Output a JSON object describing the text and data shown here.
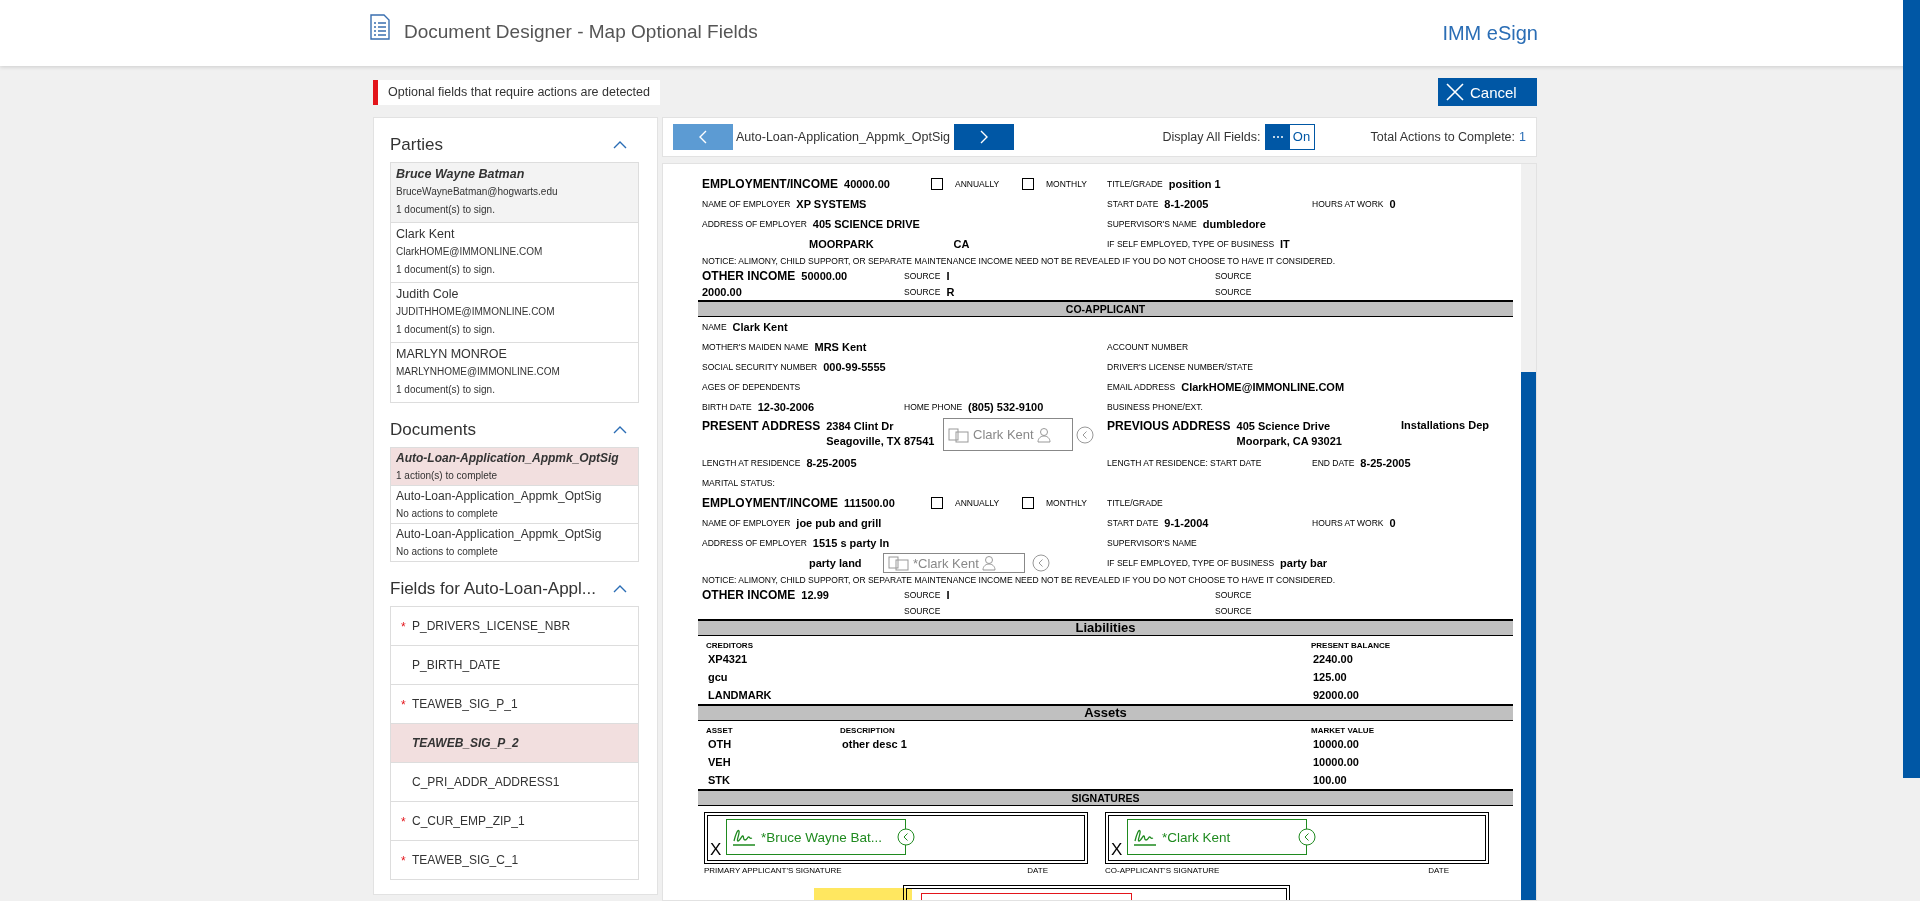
{
  "header": {
    "title": "Document Designer - Map Optional Fields",
    "brand": "IMM eSign"
  },
  "alert": {
    "text": "Optional fields that require actions are detected"
  },
  "cancel_button": {
    "label": "Cancel"
  },
  "parties": {
    "title": "Parties",
    "items": [
      {
        "name": "Bruce Wayne Batman",
        "email": "BruceWayneBatman@hogwarts.edu",
        "status": "1 document(s) to sign.",
        "selected": true
      },
      {
        "name": "Clark Kent",
        "email": "ClarkHOME@IMMONLINE.COM",
        "status": "1 document(s) to sign.",
        "selected": false
      },
      {
        "name": "Judith Cole",
        "email": "JUDITHHOME@IMMONLINE.COM",
        "status": "1 document(s) to sign.",
        "selected": false
      },
      {
        "name": "MARLYN MONROE",
        "email": "MARLYNHOME@IMMONLINE.COM",
        "status": "1 document(s) to sign.",
        "selected": false
      }
    ]
  },
  "documents": {
    "title": "Documents",
    "items": [
      {
        "name": "Auto-Loan-Application_Appmk_OptSig",
        "status": "1 action(s) to complete",
        "selected": true
      },
      {
        "name": "Auto-Loan-Application_Appmk_OptSig",
        "status": "No actions to complete",
        "selected": false
      },
      {
        "name": "Auto-Loan-Application_Appmk_OptSig",
        "status": "No actions to complete",
        "selected": false
      }
    ]
  },
  "fields": {
    "title": "Fields for Auto-Loan-Appl...",
    "items": [
      {
        "required_mark": "*",
        "name": "P_DRIVERS_LICENSE_NBR",
        "selected": false
      },
      {
        "name": "P_BIRTH_DATE",
        "selected": false
      },
      {
        "required_mark": "*",
        "name": "TEAWEB_SIG_P_1",
        "selected": false
      },
      {
        "name": "TEAWEB_SIG_P_2",
        "selected": true
      },
      {
        "name": "C_PRI_ADDR_ADDRESS1",
        "selected": false
      },
      {
        "required_mark": "*",
        "name": "C_CUR_EMP_ZIP_1",
        "selected": false
      },
      {
        "required_mark": "*",
        "name": "TEAWEB_SIG_C_1",
        "selected": false
      }
    ]
  },
  "viewer": {
    "document_name": "Auto-Loan-Application_Appmk_OptSig",
    "display_all_label": "Display All Fields:",
    "display_all": {
      "label": "On",
      "on": true
    },
    "total_label": "Total Actions to Complete:",
    "total_value": "1"
  },
  "document": {
    "rows": [
      {
        "kind": "employment",
        "cells": [
          {
            "label": "EMPLOYMENT/INCOME",
            "value": "40000.00",
            "emphasis": true
          },
          {
            "label": "ANNUALLY",
            "checked": false
          },
          {
            "label": "MONTHLY",
            "checked": false
          },
          {
            "label": "TITLE/GRADE",
            "value": "position 1"
          }
        ]
      },
      {
        "kind": "pair3",
        "cells": [
          {
            "label": "NAME OF EMPLOYER",
            "value": "XP SYSTEMS"
          },
          {
            "label": "START DATE",
            "value": "8-1-2005"
          },
          {
            "label": "HOURS AT WORK",
            "value": "0"
          }
        ]
      },
      {
        "kind": "pair2",
        "cells": [
          {
            "label": "ADDRESS OF EMPLOYER",
            "value": "405 SCIENCE DRIVE"
          },
          {
            "label": "SUPERVISOR'S NAME",
            "value": "dumbledore"
          }
        ]
      },
      {
        "kind": "city",
        "cells": [
          {
            "value": "MOORPARK"
          },
          {
            "value": "CA"
          },
          {
            "label": "IF SELF EMPLOYED, TYPE OF BUSINESS",
            "value": "IT"
          }
        ]
      },
      {
        "kind": "notice",
        "text": "NOTICE: ALIMONY, CHILD SUPPORT, OR SEPARATE MAINTENANCE INCOME NEED NOT BE REVEALED IF YOU DO NOT CHOOSE TO HAVE IT CONSIDERED."
      },
      {
        "kind": "income",
        "cells": [
          {
            "label": "OTHER INCOME",
            "value": "50000.00",
            "emphasis": true
          },
          {
            "label": "SOURCE",
            "value": "I"
          },
          {
            "label": "SOURCE"
          }
        ]
      },
      {
        "kind": "income",
        "cells": [
          {
            "value": "2000.00"
          },
          {
            "label": "SOURCE",
            "value": "R"
          },
          {
            "label": "SOURCE"
          }
        ]
      },
      {
        "kind": "heading",
        "text": "CO-APPLICANT"
      },
      {
        "kind": "pair2",
        "cells": [
          {
            "label": "NAME",
            "value": "Clark Kent"
          }
        ]
      },
      {
        "kind": "pair2",
        "cells": [
          {
            "label": "MOTHER'S MAIDEN NAME",
            "value": "MRS Kent"
          },
          {
            "label": "ACCOUNT NUMBER"
          }
        ]
      },
      {
        "kind": "pair2",
        "cells": [
          {
            "label": "SOCIAL SECURITY NUMBER",
            "value": "000-99-5555"
          },
          {
            "label": "DRIVER'S LICENSE NUMBER/STATE"
          }
        ]
      },
      {
        "kind": "pair2",
        "cells": [
          {
            "label": "AGES OF DEPENDENTS"
          },
          {
            "label": "EMAIL ADDRESS",
            "value": "ClarkHOME@IMMONLINE.COM"
          }
        ]
      },
      {
        "kind": "phone",
        "cells": [
          {
            "label": "BIRTH DATE",
            "value": "12-30-2006"
          },
          {
            "label": "HOME PHONE",
            "value": "(805) 532-9100"
          },
          {
            "label": "BUSINESS PHONE/EXT."
          }
        ]
      },
      {
        "kind": "address",
        "cells": [
          {
            "label": "PRESENT ADDRESS",
            "emphasis": true,
            "lines": [
              "2384 Clint Dr",
              "Seagoville, TX 87541"
            ]
          },
          {
            "label": "PREVIOUS ADDRESS",
            "emphasis": true,
            "lines": [
              "405 Science Drive",
              "Moorpark, CA 93021"
            ]
          },
          {
            "value": "Installations Dep"
          }
        ],
        "marker": {
          "label": "Clark Kent"
        }
      },
      {
        "kind": "pair3",
        "cells": [
          {
            "label": "LENGTH AT RESIDENCE",
            "value": "8-25-2005"
          },
          {
            "label": "LENGTH AT RESIDENCE:  START DATE"
          },
          {
            "label": "END DATE",
            "value": "8-25-2005"
          }
        ]
      },
      {
        "kind": "pair2",
        "cells": [
          {
            "label": "MARITAL STATUS:"
          }
        ]
      },
      {
        "kind": "employment",
        "cells": [
          {
            "label": "EMPLOYMENT/INCOME",
            "value": "111500.00",
            "emphasis": true
          },
          {
            "label": "ANNUALLY",
            "checked": false
          },
          {
            "label": "MONTHLY",
            "checked": false
          },
          {
            "label": "TITLE/GRADE"
          }
        ]
      },
      {
        "kind": "pair3",
        "cells": [
          {
            "label": "NAME OF EMPLOYER",
            "value": "joe pub and grill"
          },
          {
            "label": "START DATE",
            "value": "9-1-2004"
          },
          {
            "label": "HOURS AT WORK",
            "value": "0"
          }
        ]
      },
      {
        "kind": "pair2",
        "cells": [
          {
            "label": "ADDRESS OF EMPLOYER",
            "value": "1515 s party ln"
          },
          {
            "label": "SUPERVISOR'S NAME"
          }
        ]
      },
      {
        "kind": "city",
        "cells": [
          {
            "value": "party land"
          },
          {
            "label": "IF SELF EMPLOYED, TYPE OF BUSINESS",
            "value": "party bar"
          }
        ],
        "marker": {
          "label": "*Clark Kent"
        }
      },
      {
        "kind": "notice",
        "text": "NOTICE: ALIMONY, CHILD SUPPORT, OR SEPARATE MAINTENANCE INCOME NEED NOT BE REVEALED IF YOU DO NOT CHOOSE TO HAVE IT CONSIDERED."
      },
      {
        "kind": "income",
        "cells": [
          {
            "label": "OTHER INCOME",
            "value": "12.99",
            "emphasis": true
          },
          {
            "label": "SOURCE",
            "value": "I"
          },
          {
            "label": "SOURCE"
          }
        ]
      },
      {
        "kind": "income",
        "cells": [
          {
            "label": "SOURCE"
          },
          {
            "label": "SOURCE"
          }
        ]
      },
      {
        "kind": "section",
        "text": "Liabilities"
      },
      {
        "kind": "table-head",
        "cells": [
          "CREDITORS",
          "PRESENT BALANCE"
        ]
      },
      {
        "kind": "table-row",
        "cells": [
          "XP4321",
          "2240.00"
        ]
      },
      {
        "kind": "table-row",
        "cells": [
          "gcu",
          "125.00"
        ]
      },
      {
        "kind": "table-row",
        "cells": [
          "LANDMARK",
          "92000.00"
        ]
      },
      {
        "kind": "section",
        "text": "Assets"
      },
      {
        "kind": "table-head",
        "cells": [
          "ASSET",
          "DESCRIPTION",
          "MARKET VALUE"
        ]
      },
      {
        "kind": "table-row",
        "cells": [
          "OTH",
          "other desc 1",
          "10000.00"
        ]
      },
      {
        "kind": "table-row",
        "cells": [
          "VEH",
          null,
          "10000.00"
        ]
      },
      {
        "kind": "table-row",
        "cells": [
          "STK",
          null,
          "100.00"
        ]
      },
      {
        "kind": "heading",
        "text": "SIGNATURES"
      },
      {
        "kind": "signatures",
        "cells": [
          {
            "mark": "X",
            "field": "*Bruce Wayne Bat...",
            "label": "PRIMARY APPLICANT'S SIGNATURE",
            "date_label": "DATE"
          },
          {
            "mark": "X",
            "field": "*Clark Kent",
            "label": "CO-APPLICANT'S SIGNATURE",
            "date_label": "DATE"
          }
        ]
      }
    ]
  }
}
